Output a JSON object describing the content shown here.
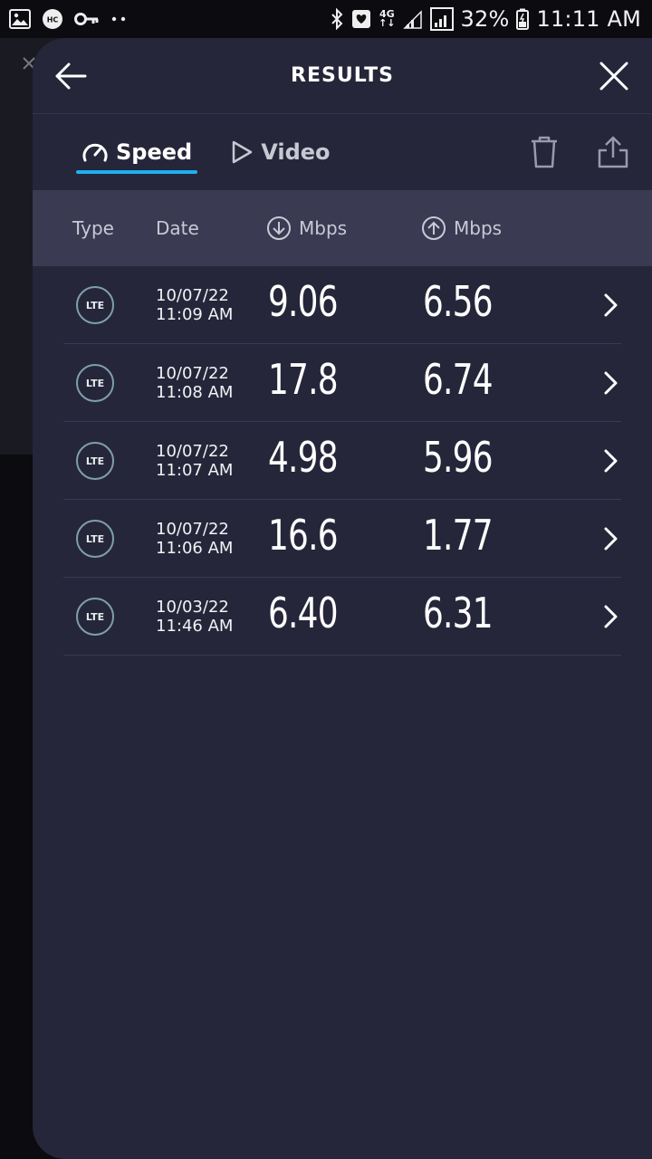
{
  "status_bar": {
    "network": "4G",
    "battery": "32%",
    "time": "11:11 AM",
    "hc_label": "HC"
  },
  "header": {
    "title": "RESULTS"
  },
  "tabs": [
    {
      "label": "Speed",
      "selected": true
    },
    {
      "label": "Video",
      "selected": false
    }
  ],
  "table": {
    "columns": {
      "type": "Type",
      "date": "Date",
      "download": "Mbps",
      "upload": "Mbps"
    },
    "rows": [
      {
        "type": "LTE",
        "date": "10/07/22",
        "time": "11:09 AM",
        "download": "9.06",
        "upload": "6.56"
      },
      {
        "type": "LTE",
        "date": "10/07/22",
        "time": "11:08 AM",
        "download": "17.8",
        "upload": "6.74"
      },
      {
        "type": "LTE",
        "date": "10/07/22",
        "time": "11:07 AM",
        "download": "4.98",
        "upload": "5.96"
      },
      {
        "type": "LTE",
        "date": "10/07/22",
        "time": "11:06 AM",
        "download": "16.6",
        "upload": "1.77"
      },
      {
        "type": "LTE",
        "date": "10/03/22",
        "time": "11:46 AM",
        "download": "6.40",
        "upload": "6.31"
      }
    ]
  },
  "colors": {
    "accent": "#1fb0f0",
    "sheet_bg": "#26263a",
    "header_bg": "#3a3a52"
  }
}
